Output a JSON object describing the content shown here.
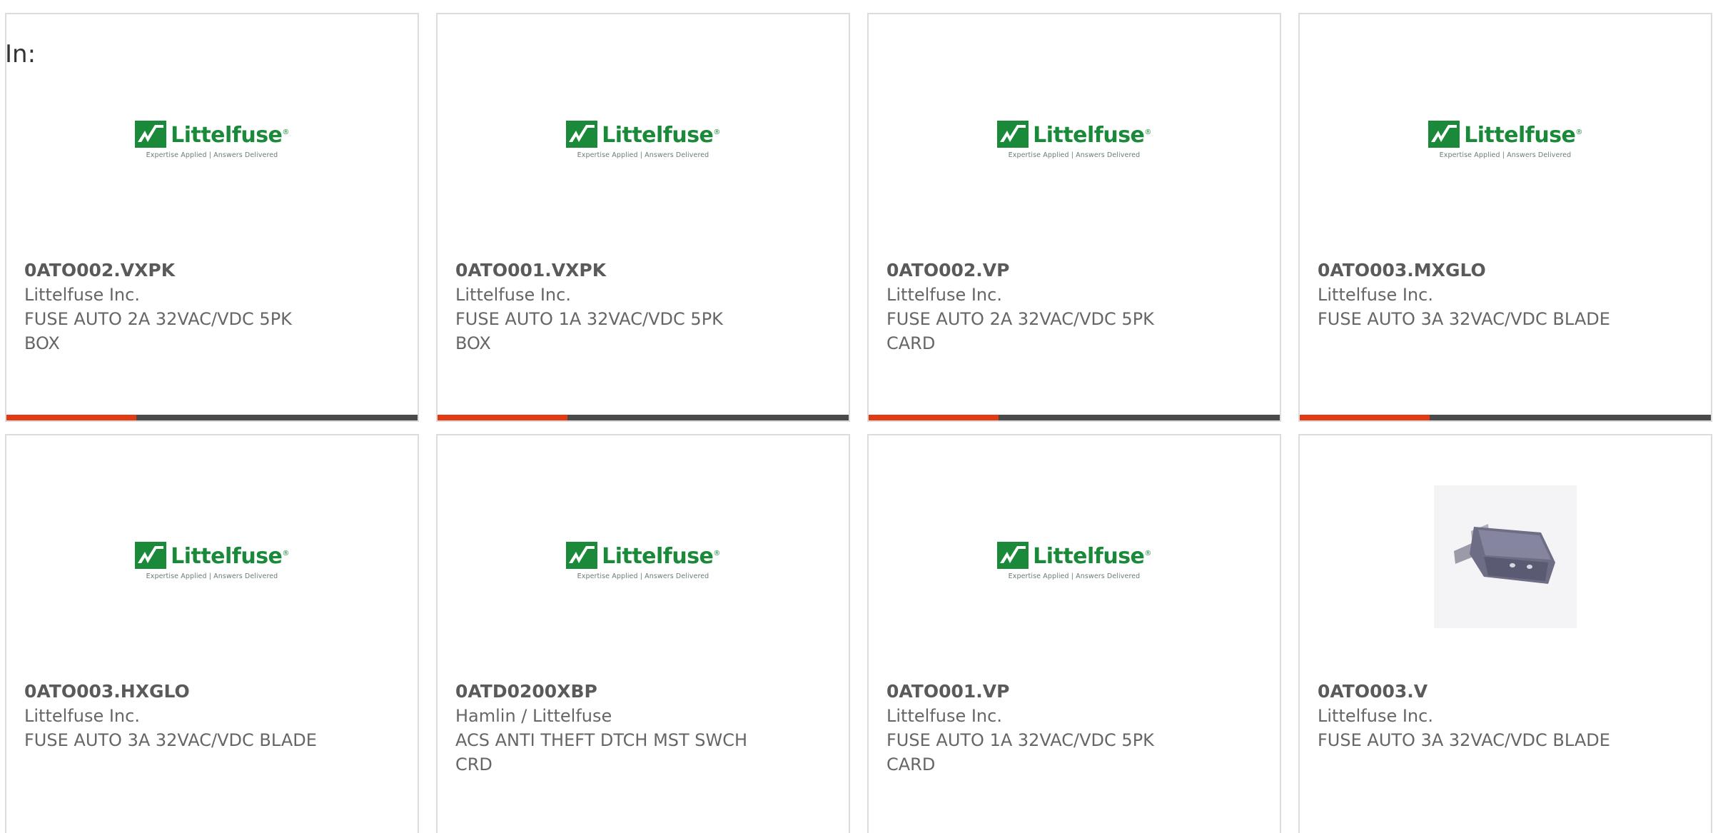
{
  "header": {
    "in_label": "In:"
  },
  "colors": {
    "accent": "#e23a12",
    "bar_dark": "#4a4a4a",
    "brand_green": "#1a8a3a",
    "card_border": "#dcdcdc"
  },
  "logo": {
    "word": "Littelfuse",
    "registered": "®",
    "tagline": "Expertise Applied | Answers Delivered"
  },
  "products": [
    {
      "part": "0ATO002.VXPK",
      "manufacturer": "Littelfuse Inc.",
      "description": "FUSE AUTO 2A 32VAC/VDC 5PK BOX",
      "image": "littelfuse-logo",
      "hover_bar": true
    },
    {
      "part": "0ATO001.VXPK",
      "manufacturer": "Littelfuse Inc.",
      "description": "FUSE AUTO 1A 32VAC/VDC 5PK BOX",
      "image": "littelfuse-logo",
      "hover_bar": true
    },
    {
      "part": "0ATO002.VP",
      "manufacturer": "Littelfuse Inc.",
      "description": "FUSE AUTO 2A 32VAC/VDC 5PK CARD",
      "image": "littelfuse-logo",
      "hover_bar": true
    },
    {
      "part": "0ATO003.MXGLO",
      "manufacturer": "Littelfuse Inc.",
      "description": "FUSE AUTO 3A 32VAC/VDC BLADE",
      "image": "littelfuse-logo",
      "hover_bar": true
    },
    {
      "part": "0ATO003.HXGLO",
      "manufacturer": "Littelfuse Inc.",
      "description": "FUSE AUTO 3A 32VAC/VDC BLADE",
      "image": "littelfuse-logo",
      "hover_bar": false
    },
    {
      "part": "0ATD0200XBP",
      "manufacturer": "Hamlin / Littelfuse",
      "description": "ACS ANTI THEFT DTCH MST SWCH CRD",
      "image": "littelfuse-logo",
      "hover_bar": false
    },
    {
      "part": "0ATO001.VP",
      "manufacturer": "Littelfuse Inc.",
      "description": "FUSE AUTO 1A 32VAC/VDC 5PK CARD",
      "image": "littelfuse-logo",
      "hover_bar": false
    },
    {
      "part": "0ATO003.V",
      "manufacturer": "Littelfuse Inc.",
      "description": "FUSE AUTO 3A 32VAC/VDC BLADE",
      "image": "blade-fuse-photo",
      "hover_bar": false
    }
  ]
}
